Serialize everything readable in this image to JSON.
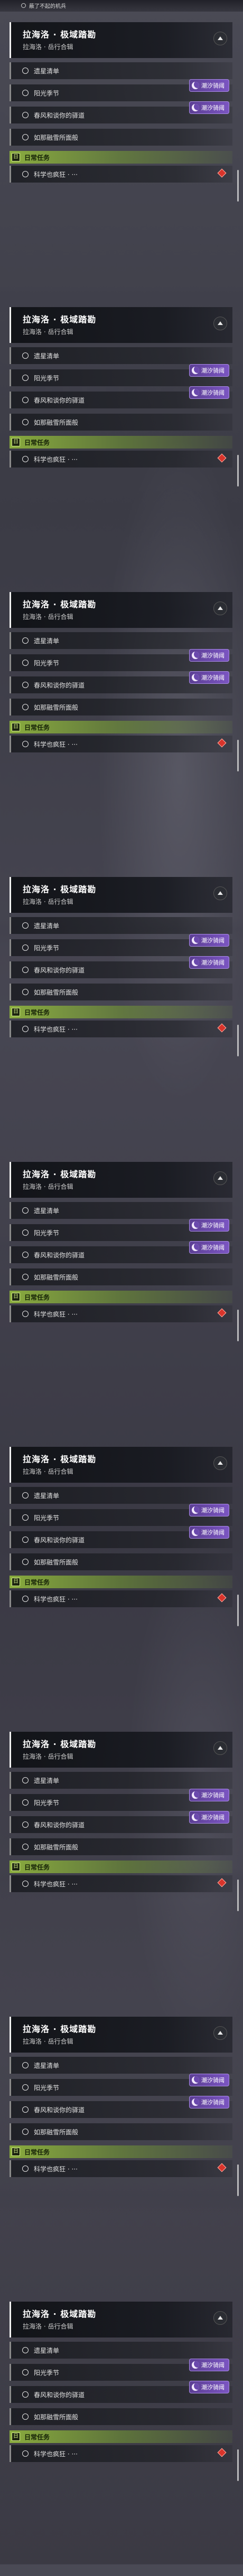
{
  "top_partial": {
    "text": "蔽了不起的机兵"
  },
  "quest": {
    "title": "拉海洛 · 极域踏勘",
    "subtitle": "拉海洛 · 岳行合辑",
    "objectives": [
      {
        "label": "遗星清单"
      },
      {
        "label": "阳光季节",
        "badge": "潮汐骑阈"
      },
      {
        "label": "春风和谈你的驿道",
        "badge": "潮汐骑阈"
      },
      {
        "label": "如那融雪所面般"
      }
    ]
  },
  "daily": {
    "tag": "日",
    "title": "日常任务",
    "item": "科学也疯狂 · ···"
  },
  "badge_color": "#7b55c2",
  "daily_color": "#96be3c",
  "icons": {
    "collapse": "chevron-up-icon",
    "objective": "ring-icon",
    "badge": "moon-icon",
    "daily_marker": "diamond-icon"
  },
  "panel_count": 9
}
